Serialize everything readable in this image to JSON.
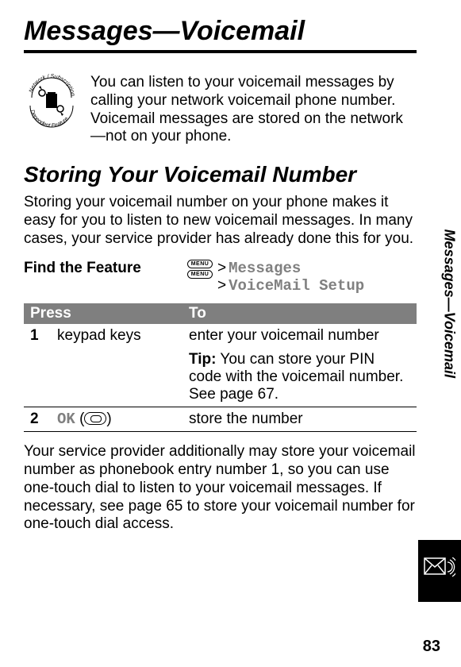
{
  "chapter_title": "Messages—Voicemail",
  "intro_text": "You can listen to your voicemail messages by calling your network voicemail phone number. Voicemail messages are stored on the network—not on your phone.",
  "section_title": "Storing Your Voicemail Number",
  "section_body": "Storing your voicemail number on your phone makes it easy for you to listen to new voicemail messages. In many cases, your service provider has already done this for you.",
  "find_feature_label": "Find the Feature",
  "menu_key_label": "MENU",
  "nav": {
    "line1_gt": ">",
    "line1_text": "Messages",
    "line2_gt": ">",
    "line2_text": "VoiceMail Setup"
  },
  "table": {
    "head_press": "Press",
    "head_to": "To",
    "rows": [
      {
        "num": "1",
        "press": "keypad keys",
        "to": "enter your voicemail number",
        "tip_label": "Tip:",
        "tip_text": " You can store your PIN code with the voicemail number. See page 67."
      },
      {
        "num": "2",
        "press_key": "OK",
        "press_suffix": " (",
        "press_close": ")",
        "to": "store the number"
      }
    ]
  },
  "post_text": "Your service provider additionally may store your voicemail number as phonebook entry number 1, so you can use one-touch dial to listen to your voicemail messages. If necessary, see page 65 to store your voicemail number for one-touch dial access.",
  "side_tab_text": "Messages—Voicemail",
  "page_number": "83"
}
